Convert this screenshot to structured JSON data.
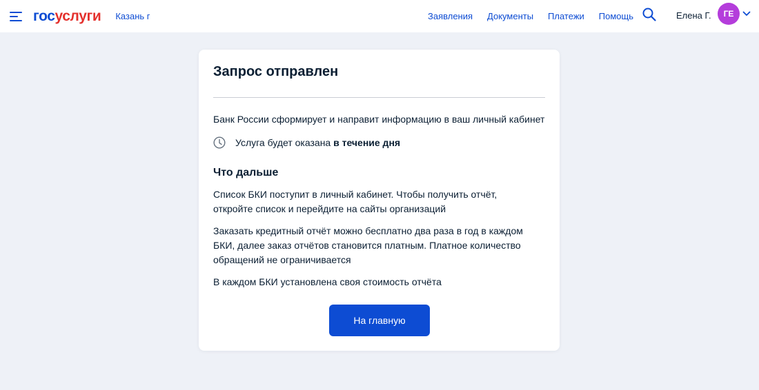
{
  "header": {
    "logo_part1": "гос",
    "logo_part2": "услуги",
    "city": "Казань г",
    "nav": [
      "Заявления",
      "Документы",
      "Платежи",
      "Помощь"
    ],
    "user_name": "Елена Г.",
    "avatar_initials": "ГЕ",
    "icons": [
      "burger-menu-icon",
      "search-icon",
      "chevron-down-icon"
    ]
  },
  "card": {
    "title": "Запрос отправлен",
    "info_text": "Банк России сформирует и направит информацию в ваш личный кабинет",
    "service_time_prefix": "Услуга будет оказана ",
    "service_time_bold": "в течение дня",
    "subtitle": "Что дальше",
    "paragraphs": [
      "Список БКИ поступит в личный кабинет. Чтобы получить отчёт, откройте список и перейдите на сайты организаций",
      "Заказать кредитный отчёт можно бесплатно два раза в год в каждом БКИ, далее заказ отчётов становится платным. Платное количество обращений не ограничивается",
      "В каждом БКИ установлена своя стоимость отчёта"
    ],
    "button_label": "На главную"
  },
  "colors": {
    "brand_blue": "#0d4cd3",
    "brand_red": "#e4312d",
    "avatar": "#b43ddb",
    "background": "#eef1f7"
  }
}
